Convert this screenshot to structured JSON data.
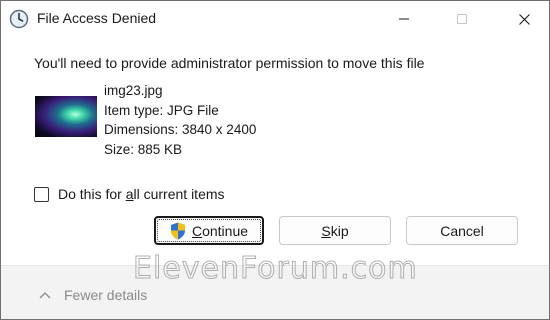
{
  "window": {
    "title": "File Access Denied",
    "icons": {
      "app": "clock-icon",
      "minimize": "minimize-icon",
      "maximize": "maximize-icon",
      "close": "close-icon"
    }
  },
  "dialog": {
    "message": "You'll need to provide administrator permission to move this file",
    "file": {
      "thumbnail_icon": "image-thumbnail",
      "name": "img23.jpg",
      "item_type": "Item type: JPG File",
      "dimensions": "Dimensions: 3840 x 2400",
      "size": "Size: 885 KB"
    },
    "checkbox": {
      "label_pre": "Do this for ",
      "label_accel": "a",
      "label_post": "ll current items",
      "checked": false
    },
    "buttons": {
      "continue_accel": "C",
      "continue_rest": "ontinue",
      "skip_accel": "S",
      "skip_rest": "kip",
      "cancel": "Cancel",
      "continue_icon": "uac-shield-icon"
    },
    "footer": {
      "details_label": "Fewer details",
      "details_icon": "chevron-up-icon"
    }
  },
  "watermark": "ElevenForum.com"
}
